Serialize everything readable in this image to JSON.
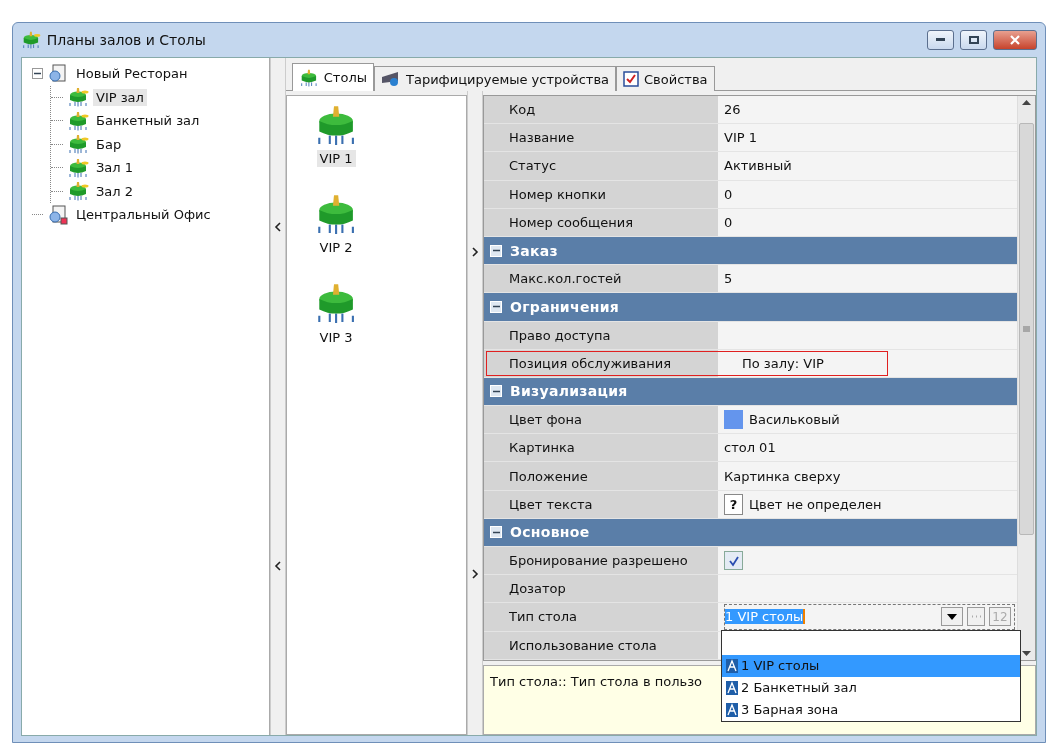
{
  "window": {
    "title": "Планы залов и Столы"
  },
  "tree": [
    {
      "label": "Новый Ресторан",
      "kind": "restaurant",
      "selected": false,
      "expanded": true,
      "children": [
        {
          "label": "VIP зал",
          "kind": "hall",
          "selected": true
        },
        {
          "label": "Банкетный зал",
          "kind": "hall",
          "selected": false
        },
        {
          "label": "Бар",
          "kind": "hall",
          "selected": false
        },
        {
          "label": "Зал 1",
          "kind": "hall",
          "selected": false
        },
        {
          "label": "Зал 2",
          "kind": "hall",
          "selected": false
        }
      ]
    },
    {
      "label": "Центральный Офис",
      "kind": "office",
      "selected": false
    }
  ],
  "tabs": [
    {
      "label": "Столы",
      "kind": "tables",
      "selected": true
    },
    {
      "label": "Тарифицируемые устройства",
      "kind": "devices",
      "selected": false
    },
    {
      "label": "Свойства",
      "kind": "properties",
      "selected": false
    }
  ],
  "tables": [
    {
      "label": "VIP 1",
      "selected": true
    },
    {
      "label": "VIP 2",
      "selected": false
    },
    {
      "label": "VIP 3",
      "selected": false
    }
  ],
  "property_grid": {
    "rows": [
      {
        "kind": "text",
        "label": "Код",
        "value": "26",
        "highlighted": false
      },
      {
        "kind": "text",
        "label": "Название",
        "value": "VIP 1",
        "highlighted": false
      },
      {
        "kind": "text",
        "label": "Статус",
        "value": "Активный",
        "highlighted": false
      },
      {
        "kind": "text",
        "label": "Номер кнопки",
        "value": "0",
        "highlighted": false
      },
      {
        "kind": "text",
        "label": "Номер сообщения",
        "value": "0",
        "highlighted": false
      },
      {
        "kind": "category",
        "label": "Заказ",
        "expanded": true
      },
      {
        "kind": "text",
        "label": "Макс.кол.гостей",
        "value": "5",
        "highlighted": false
      },
      {
        "kind": "category",
        "label": "Ограничения",
        "expanded": true
      },
      {
        "kind": "empty",
        "label": "Право доступа",
        "highlighted": false
      },
      {
        "kind": "text",
        "label": "Позиция обслуживания",
        "value": "По залу: VIP",
        "highlighted": true
      },
      {
        "kind": "category",
        "label": "Визуализация",
        "expanded": true
      },
      {
        "kind": "color",
        "label": "Цвет фона",
        "value": "Васильковый",
        "color": "#6495ed",
        "highlighted": false
      },
      {
        "kind": "text",
        "label": "Картинка",
        "value": "стол 01",
        "highlighted": false
      },
      {
        "kind": "text",
        "label": "Положение",
        "value": "Картинка сверху",
        "highlighted": false
      },
      {
        "kind": "unknown_color",
        "label": "Цвет текста",
        "value": "Цвет не определен",
        "mark": "?",
        "highlighted": false
      },
      {
        "kind": "category",
        "label": "Основное",
        "expanded": true
      },
      {
        "kind": "checkbox",
        "label": "Бронирование разрешено",
        "checked": true,
        "highlighted": false
      },
      {
        "kind": "empty",
        "label": "Дозатор",
        "highlighted": false
      },
      {
        "kind": "combo",
        "label": "Тип стола",
        "value": "1 VIP столы",
        "counter": "12",
        "highlighted": false
      },
      {
        "kind": "empty",
        "label": "Использование стола",
        "highlighted": false
      }
    ]
  },
  "dropdown": {
    "items": [
      {
        "label": "1 VIP столы",
        "selected": true
      },
      {
        "label": "2 Банкетный зал",
        "selected": false
      },
      {
        "label": "3 Барная зона",
        "selected": false
      }
    ]
  },
  "help": {
    "text": "Тип стола:: Тип стола в пользо"
  }
}
